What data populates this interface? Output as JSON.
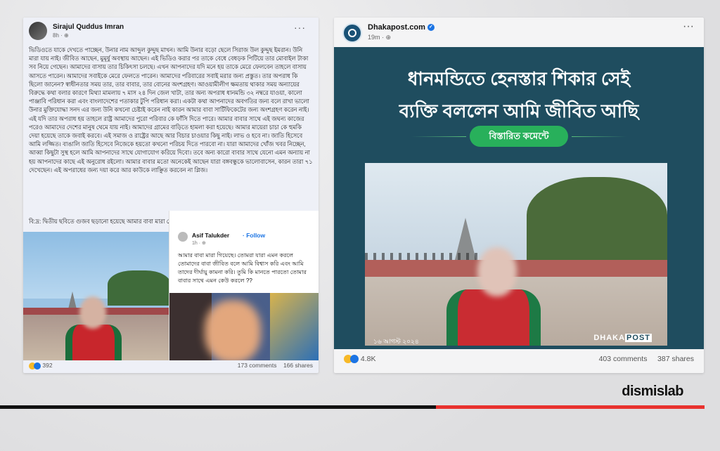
{
  "left_post": {
    "author": "Sirajul Quddus Imran",
    "time": "8h · ⊕",
    "menu": "···",
    "body": "ভিডিওতে যাকে দেখতে পাচ্ছেন, উনার নাম আব্দুল কুদ্দুছ মাখন। আমি উনার বড়ো ছেলে সিরাজ উল কুদ্দুছ ইমরান। উনি মারা যায় নাই। জীবিত আছেন, মুমূর্ষু অবস্থায় আছেন। এই ভিডিও করার পর তাকে বেধে বেধড়ক পিটিয়ে তার মোবাইল টাকা সব নিয়ে গেছেন। আমাদের বাসায় তার চিকিৎসা চলছে। এখন আপনাদের যদি মনে হয় তাকে মেরে ফেলবেন তাহলে বাসায় আসতে পারেন। আমাদের সবাইকে মেরে ফেলতে পারেন। আমাদের পরিবারের সবাই মরার জন্য প্রস্তুত। তার অপরাধ কি ছিলো জানেন? স্বাধীনতার সময় তার, তার বাবার, তার বোনের অংশগ্রহণ। আওয়ামীলীগ ক্ষমতায় থাকার সময় অন্যায়ের বিরুদ্ধে কথা বলার কারণে মিথ্যা মামলায় ৭ মাস ২৪ দিন জেল খাটা, তার অন্য অপরাধ ধানমন্ডি ৩২ নম্বরে যাওয়া, কালো পাঞ্জাবি পরিধান করা এবং বাংলাদেশের পতাকার টুপি পরিধান করা। একটা কথা আপনাদের অবগতির জন্য বলে রাখা ভালো উনার মুক্তিযোদ্ধা সনদ এর জন্য উনি কখনো চেষ্টাই করেন নাই কারন আমার বাবা সার্টিফিকেটের জন্য অংশগ্রহণ করেন নাই। এই যদি তার অপরাধ হয় তাহলে রাষ্ট্র আমাদের পুরো পরিবার কে ফাঁসি দিতে পারে। আমার বাবার সাথে এই জঘন্য কাজের পরেও আমাদের দেশের মানুষ থেমে যায় নাই। আমাদের গ্রামের বাড়িতে হামলা করা হয়েছে। আমার মায়েরা চাচা কে হুমকি দেয়া হয়েছে তাকে জবাই করবে। এই সমাজ ও রাষ্ট্রের আছে আর বিচার চাওয়ার কিছু নাই। লাভ ও হবে না। জাতি হিসেবে আমি লজ্জিত। বাঙালি জাতি হিসেবে নিজেকে হয়তো কখনো পরিচয় দিতে পারবো না। যারা আমাদের খোঁজ খবর নিচ্ছেন, আব্বা কিছুটা সুস্থ হলে আমি আপনাদের সাথে যোগাযোগ করিয়ে দিবো। তবে অন্য কারো বাবার সাথে যেনো এমন অন্যায় না হয় আপনাদের কাছে এই অনুরোধ রইলো। আমার বাবার মতো অনেকেই আছেন যারা বঙ্গবন্ধুকে ভালোবাসেন, কারন তারা ৭১ দেখেছেন। এই অপরাধের জন্য দয়া করে আর কাউকে লাঞ্ছিত করবেন না প্লিজ।",
    "note": "বি:দ্র: দ্বিতীয় ছবিতে গুজব ছড়ানো হয়েছে আমার বাবা মারা গেছেন।",
    "shared": {
      "author": "Asif Talukder",
      "follow": "· Follow",
      "time": "1h · ⊕",
      "text": "আমার বাবা মারা গিয়েছে। তোমরা যারা এমন করলে তোমাদের বাবা জীবিত বলে আমি বিশ্বাস করি এবং আমি তাদের দীর্ঘায়ু কামনা করি। তুমি কি মানতে পারতো তোমার বাবার সাথে এমন কেউ করলে ??"
    },
    "reactions": "392",
    "comments": "173 comments",
    "shares": "166 shares"
  },
  "right_post": {
    "author": "Dhakapost.com",
    "time": "19m · ⊕",
    "menu": "···",
    "headline_line1": "ধানমন্ডিতে হেনস্তার শিকার সেই",
    "headline_line2": "ব্যক্তি বললেন আমি জীবিত আছি",
    "pill": "বিস্তারিত কমেন্টে",
    "date": "১৬ আগস্ট ২০২৪",
    "logo_a": "DHAKA",
    "logo_b": "POST",
    "reactions": "4.8K",
    "comments": "403 comments",
    "shares": "387 shares"
  },
  "brand": "dismislab",
  "colors": {
    "card_bg": "#1f4d5f",
    "pill_green": "#28b05b",
    "brand_red": "#e8322f"
  }
}
